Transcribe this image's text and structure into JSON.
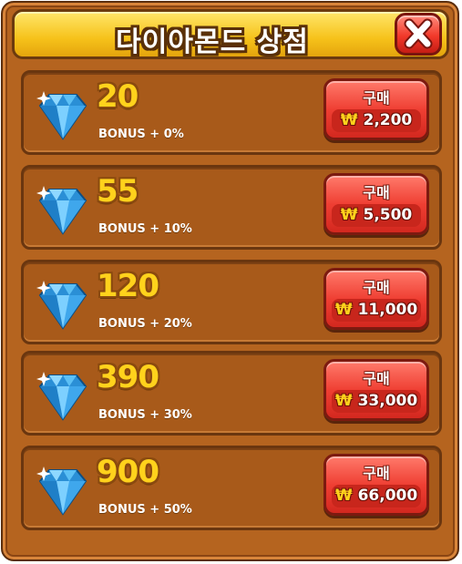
{
  "shop": {
    "title": "다이아몬드 상점",
    "close_icon": "close-x-icon",
    "buy_label": "구매",
    "currency_symbol": "₩",
    "colors": {
      "frame": "#b5641f",
      "title_bar": "#f6c21a",
      "amount_text": "#ffd21c",
      "buy_button": "#ef3f33",
      "close_button": "#f2392a"
    },
    "items": [
      {
        "amount": "20",
        "bonus": "BONUS + 0%",
        "price": "2,200",
        "icon": "diamond-icon"
      },
      {
        "amount": "55",
        "bonus": "BONUS + 10%",
        "price": "5,500",
        "icon": "diamond-icon"
      },
      {
        "amount": "120",
        "bonus": "BONUS + 20%",
        "price": "11,000",
        "icon": "diamond-icon"
      },
      {
        "amount": "390",
        "bonus": "BONUS + 30%",
        "price": "33,000",
        "icon": "diamond-icon"
      },
      {
        "amount": "900",
        "bonus": "BONUS + 50%",
        "price": "66,000",
        "icon": "diamond-icon"
      }
    ]
  }
}
